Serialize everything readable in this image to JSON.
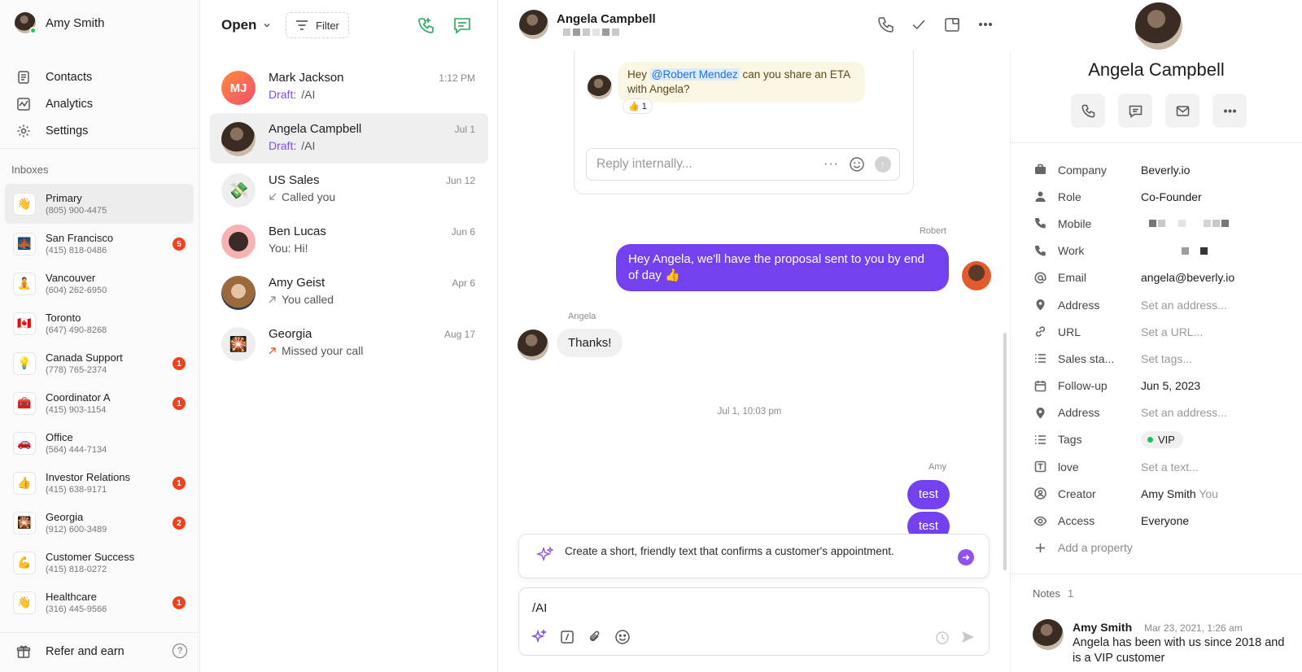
{
  "user": {
    "name": "Amy Smith"
  },
  "nav": [
    {
      "label": "Contacts",
      "icon": "contacts-icon"
    },
    {
      "label": "Analytics",
      "icon": "analytics-icon"
    },
    {
      "label": "Settings",
      "icon": "gear-icon"
    }
  ],
  "inboxes_title": "Inboxes",
  "inboxes": [
    {
      "name": "Primary",
      "phone": "(805) 900-4475",
      "emoji": "👋",
      "badge": ""
    },
    {
      "name": "San Francisco",
      "phone": "(415) 818-0486",
      "emoji": "🌉",
      "badge": "5"
    },
    {
      "name": "Vancouver",
      "phone": "(604) 262-6950",
      "emoji": "🧘",
      "badge": ""
    },
    {
      "name": "Toronto",
      "phone": "(647) 490-8268",
      "emoji": "🇨🇦",
      "badge": ""
    },
    {
      "name": "Canada Support",
      "phone": "(778) 765-2374",
      "emoji": "💡",
      "badge": "1"
    },
    {
      "name": "Coordinator A",
      "phone": "(415) 903-1154",
      "emoji": "🧰",
      "badge": "1"
    },
    {
      "name": "Office",
      "phone": "(564) 444-7134",
      "emoji": "🚗",
      "badge": ""
    },
    {
      "name": "Investor Relations",
      "phone": "(415) 638-9171",
      "emoji": "👍",
      "badge": "1"
    },
    {
      "name": "Georgia",
      "phone": "(912) 600-3489",
      "emoji": "🎇",
      "badge": "2"
    },
    {
      "name": "Customer Success",
      "phone": "(415) 818-0272",
      "emoji": "💪",
      "badge": ""
    },
    {
      "name": "Healthcare",
      "phone": "(316) 445-9566",
      "emoji": "👋",
      "badge": "1"
    }
  ],
  "refer": {
    "label": "Refer and earn",
    "help": "?"
  },
  "list_header": {
    "status": "Open",
    "filter": "Filter"
  },
  "conversations": [
    {
      "name": "Mark Jackson",
      "initials": "MJ",
      "time": "1:12 PM",
      "draft_label": "Draft:",
      "preview": "/AI",
      "kind": "draft"
    },
    {
      "name": "Angela Campbell",
      "initials": "",
      "time": "Jul 1",
      "draft_label": "Draft:",
      "preview": "/AI",
      "kind": "draft"
    },
    {
      "name": "US Sales",
      "initials": "",
      "time": "Jun 12",
      "preview": "Called you",
      "kind": "call-in"
    },
    {
      "name": "Ben Lucas",
      "initials": "",
      "time": "Jun 6",
      "preview": "You: Hi!",
      "kind": "text"
    },
    {
      "name": "Amy Geist",
      "initials": "",
      "time": "Apr 6",
      "preview": "You called",
      "kind": "call-out"
    },
    {
      "name": "Georgia",
      "initials": "",
      "time": "Aug 17",
      "preview": "Missed your call",
      "kind": "missed"
    }
  ],
  "chat": {
    "contact_name": "Angela Campbell",
    "internal_note": {
      "before": "Hey ",
      "mention": "@Robert Mendez",
      "after": " can you share an ETA with Angela?",
      "reaction": "👍 1"
    },
    "reply_internally_placeholder": "Reply internally...",
    "messages": {
      "robert_label": "Robert",
      "robert_text": "Hey Angela, we'll have the proposal sent to you by end of day 👍",
      "angela_label": "Angela",
      "angela_text": "Thanks!",
      "date_separator": "Jul 1, 10:03 pm",
      "amy_label": "Amy",
      "amy_text_1": "test",
      "amy_text_2": "test"
    },
    "ai_prompt": "Create a short, friendly text that confirms a customer's appointment.",
    "composer_value": "/AI"
  },
  "contact": {
    "name": "Angela Campbell",
    "properties": [
      {
        "key": "Company",
        "value": "Beverly.io",
        "icon": "briefcase-icon",
        "muted": false
      },
      {
        "key": "Role",
        "value": "Co-Founder",
        "icon": "person-icon",
        "muted": false
      },
      {
        "key": "Mobile",
        "value": "",
        "icon": "phone-icon",
        "muted": false
      },
      {
        "key": "Work",
        "value": "",
        "icon": "phone-icon",
        "muted": false
      },
      {
        "key": "Email",
        "value": "angela@beverly.io",
        "icon": "at-icon",
        "muted": false
      },
      {
        "key": "Address",
        "value": "Set an address...",
        "icon": "pin-icon",
        "muted": true
      },
      {
        "key": "URL",
        "value": "Set a URL...",
        "icon": "link-icon",
        "muted": true
      },
      {
        "key": "Sales sta...",
        "value": "Set tags...",
        "icon": "list-icon",
        "muted": true
      },
      {
        "key": "Follow-up",
        "value": "Jun 5, 2023",
        "icon": "calendar-icon",
        "muted": false
      },
      {
        "key": "Address",
        "value": "Set an address...",
        "icon": "pin-icon",
        "muted": true
      },
      {
        "key": "Tags",
        "value": "VIP",
        "icon": "list-icon",
        "muted": false
      },
      {
        "key": "love",
        "value": "Set a text...",
        "icon": "text-icon",
        "muted": true
      },
      {
        "key": "Creator",
        "value": "Amy Smith",
        "suffix": "You",
        "icon": "user-circle-icon",
        "muted": false
      },
      {
        "key": "Access",
        "value": "Everyone",
        "icon": "eye-icon",
        "muted": false
      }
    ],
    "add_property": "Add a property",
    "notes_label": "Notes",
    "notes_count": "1",
    "note": {
      "author": "Amy Smith",
      "time": "Mar 23, 2021, 1:26 am",
      "body": "Angela has been with us since 2018 and is a VIP customer"
    }
  },
  "colors": {
    "accent": "#7341f0",
    "badge": "#f0421d",
    "green": "#2bc253"
  }
}
